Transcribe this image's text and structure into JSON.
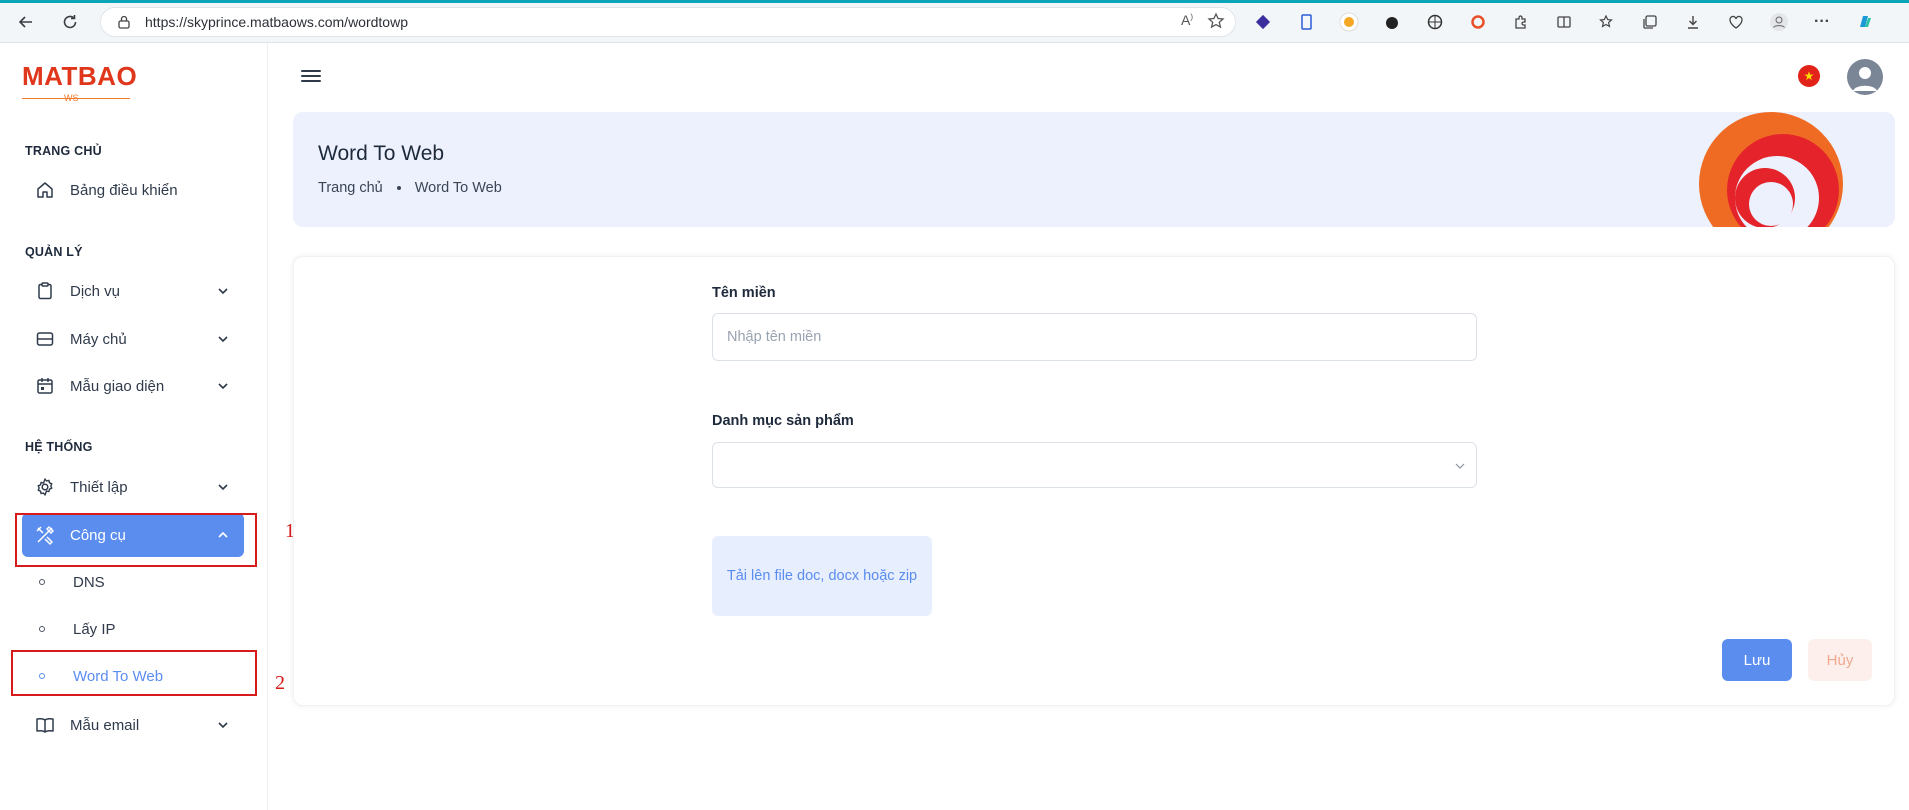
{
  "browser": {
    "url": "https://skyprince.matbaows.com/wordtowp"
  },
  "logo": {
    "brand": "MATBAO",
    "sub": "WS"
  },
  "sidebar": {
    "section_home": "TRANG CHỦ",
    "dashboard": "Bảng điều khiển",
    "section_manage": "QUẢN LÝ",
    "services": "Dịch vụ",
    "servers": "Máy chủ",
    "templates": "Mẫu giao diện",
    "section_system": "HỆ THỐNG",
    "settings": "Thiết lập",
    "tools": "Công cụ",
    "dns": "DNS",
    "get_ip": "Lấy IP",
    "word_to_web": "Word To Web",
    "email_templates": "Mẫu email"
  },
  "annotations": {
    "one": "1",
    "two": "2"
  },
  "banner": {
    "title": "Word To Web",
    "crumb_home": "Trang chủ",
    "crumb_current": "Word To Web"
  },
  "form": {
    "domain_label": "Tên miền",
    "domain_placeholder": "Nhập tên miền",
    "domain_value": "",
    "category_label": "Danh mục sản phẩm",
    "category_value": "",
    "upload_text": "Tải lên file doc, docx hoặc zip",
    "save": "Lưu",
    "cancel": "Hủy"
  },
  "colors": {
    "accent": "#5b8def",
    "brand_red": "#e0361b",
    "annotation_red": "#d71a1a"
  },
  "icons": [
    "back-icon",
    "refresh-icon",
    "lock-icon",
    "read-aloud-icon",
    "favorite-star-icon",
    "home-icon",
    "clipboard-icon",
    "server-icon",
    "calendar-icon",
    "gear-icon",
    "tools-icon",
    "book-icon",
    "chevron-down-icon",
    "chevron-up-icon",
    "hamburger-icon",
    "flag-icon",
    "avatar-icon"
  ]
}
